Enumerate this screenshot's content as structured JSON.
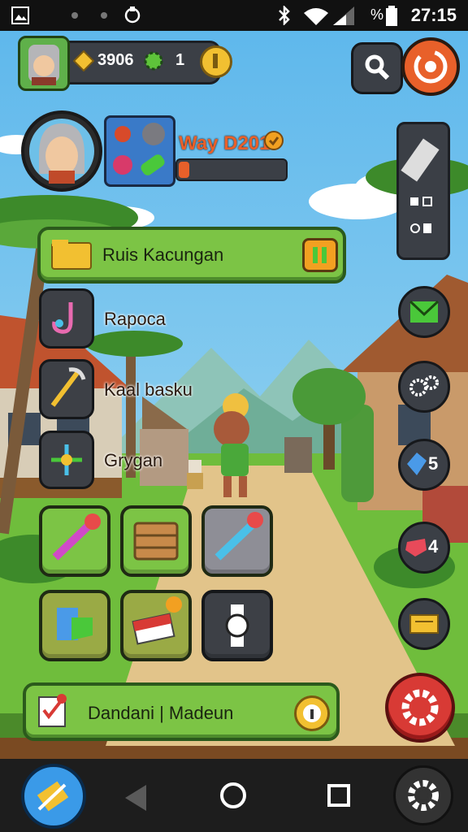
{
  "status_bar": {
    "battery": "%",
    "time": "27:15"
  },
  "currency": {
    "gems": "3906",
    "coins": "1"
  },
  "player": {
    "name": "Way D201",
    "xp_progress": 0.1
  },
  "quest_banner": {
    "label": "Ruis Kacungan"
  },
  "menu": {
    "items": [
      {
        "label": "Rapoca"
      },
      {
        "label": "Kaal basku"
      },
      {
        "label": "Grygan"
      }
    ]
  },
  "right_badges": {
    "gem_count": "5",
    "heart_count": "4"
  },
  "bottom_banner": {
    "label": "Dandani | Madeun"
  },
  "colors": {
    "accent_green": "#7cc445",
    "accent_orange": "#e8602a",
    "settings_red": "#d83a35"
  }
}
